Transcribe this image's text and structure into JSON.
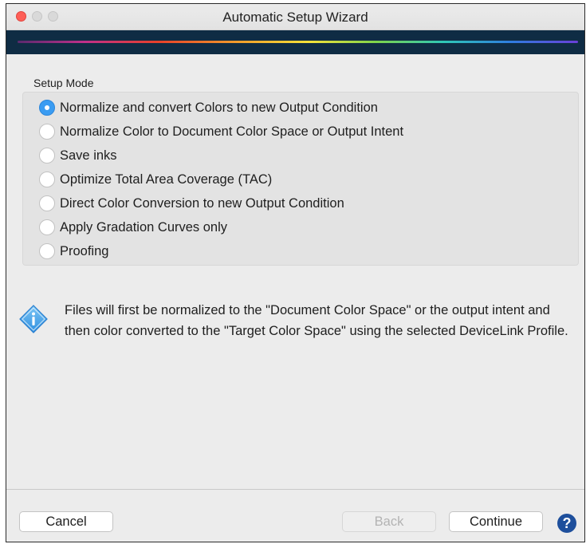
{
  "window": {
    "title": "Automatic Setup Wizard"
  },
  "setup_mode": {
    "label": "Setup Mode",
    "selected_index": 0,
    "options": [
      "Normalize and convert Colors to new Output Condition",
      "Normalize Color to Document Color Space or Output Intent",
      "Save inks",
      "Optimize Total Area Coverage (TAC)",
      "Direct Color Conversion to new Output Condition",
      "Apply Gradation Curves only",
      "Proofing"
    ]
  },
  "info": {
    "icon": "info-diamond-icon",
    "text": "Files will first be normalized to the \"Document Color Space\" or the output intent and then color converted to the \"Target Color Space\" using the selected DeviceLink Profile."
  },
  "buttons": {
    "cancel": "Cancel",
    "back": "Back",
    "continue": "Continue",
    "help_icon": "help-icon"
  },
  "colors": {
    "accent": "#3a9cf2",
    "banner": "#0f2c44",
    "info_icon": "#3ea0e8",
    "help_icon": "#1e4f9c"
  }
}
